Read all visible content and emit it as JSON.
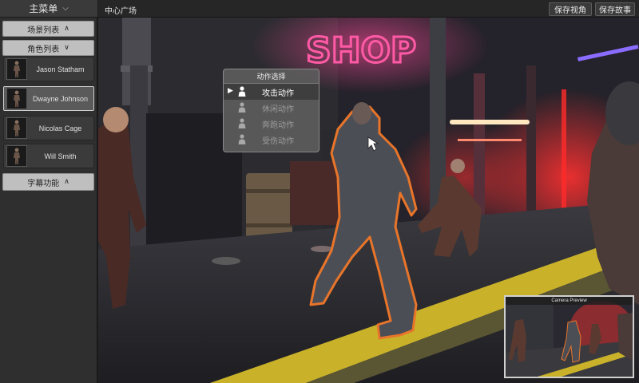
{
  "sidebar": {
    "main_menu": {
      "label": "主菜单",
      "chevron_icon": "chevron-down-icon"
    },
    "scene_list": {
      "label": "场景列表",
      "chevron_icon": "chevron-up-icon"
    },
    "character_list": {
      "label": "角色列表",
      "chevron_icon": "chevron-down-icon"
    },
    "characters": [
      {
        "name": "Jason Statham",
        "selected": false,
        "icon": "character-silhouette-icon"
      },
      {
        "name": "Dwayne Johnson",
        "selected": true,
        "icon": "character-silhouette-icon"
      },
      {
        "name": "Nicolas Cage",
        "selected": false,
        "icon": "character-silhouette-icon"
      },
      {
        "name": "Will Smith",
        "selected": false,
        "icon": "character-silhouette-icon"
      }
    ],
    "subtitle_function": {
      "label": "字幕功能",
      "chevron_icon": "chevron-up-icon"
    }
  },
  "top_bar": {
    "scene_name": "中心广场",
    "save_view_label": "保存视角",
    "save_story_label": "保存故事"
  },
  "viewport": {
    "neon_sign_text": "SHOP"
  },
  "action_menu": {
    "title": "动作选择",
    "items": [
      {
        "label": "攻击动作",
        "active": true,
        "icon": "pawn-icon"
      },
      {
        "label": "休闲动作",
        "active": false,
        "icon": "pawn-icon"
      },
      {
        "label": "奔跑动作",
        "active": false,
        "icon": "pawn-icon"
      },
      {
        "label": "受伤动作",
        "active": false,
        "icon": "pawn-icon"
      }
    ],
    "selected_indicator_icon": "play-arrow-icon"
  },
  "camera_preview": {
    "label": "Camera Preview"
  },
  "colors": {
    "highlight_outline": "#e8752a",
    "neon_pink": "#ff3d8a",
    "panel_bg": "#2f2f2f"
  }
}
